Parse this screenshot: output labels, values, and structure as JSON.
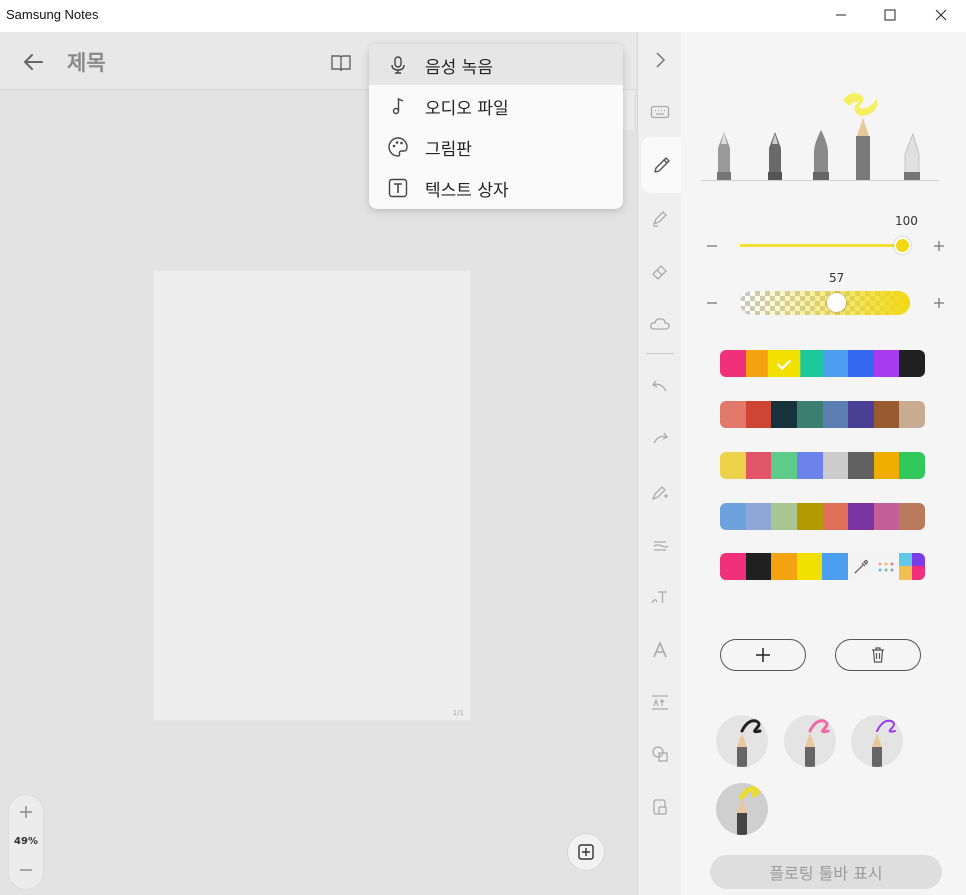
{
  "window": {
    "title": "Samsung Notes",
    "controls": [
      "minimize-icon",
      "maximize-icon",
      "close-icon"
    ]
  },
  "note": {
    "title": "제목",
    "page_indicator": "1/1",
    "zoom_level": "49%"
  },
  "menu": {
    "items": [
      {
        "label": "음성 녹음",
        "icon": "microphone-icon",
        "highlighted": true
      },
      {
        "label": "오디오 파일",
        "icon": "music-note-icon",
        "highlighted": false
      },
      {
        "label": "그림판",
        "icon": "palette-icon",
        "highlighted": false
      },
      {
        "label": "텍스트 상자",
        "icon": "text-box-icon",
        "highlighted": false
      }
    ]
  },
  "tool_strip": {
    "items": [
      "collapse-chevron-icon",
      "keyboard-icon",
      "pen-icon",
      "highlighter-icon",
      "eraser-icon",
      "lasso-icon",
      "undo-icon",
      "redo-icon",
      "handwriting-icon",
      "straighten-icon",
      "text-convert-icon",
      "font-style-icon",
      "spacing-icon",
      "shapes-icon",
      "lock-icon"
    ],
    "selected": "pen-icon"
  },
  "pen_panel": {
    "pen_types": [
      "fountain-pen-icon",
      "calligraphy-pen-icon",
      "brush-pen-icon",
      "pencil-icon",
      "marker-icon"
    ],
    "selected_pen": "pencil-icon",
    "size": {
      "value": "100",
      "fraction": 1.0
    },
    "opacity": {
      "value": "57",
      "fraction": 0.57
    },
    "accent_color": "#f2d913",
    "palettes": [
      [
        "#f0307a",
        "#f2a30f",
        "#f2e000",
        "#1cc99a",
        "#4b9ef0",
        "#3567f0",
        "#a63bf0",
        "#202020"
      ],
      [
        "#e2786a",
        "#cf4534",
        "#16323a",
        "#3a7f70",
        "#5a7fb0",
        "#4a3f95",
        "#9a5a30",
        "#c8ac92"
      ],
      [
        "#ecd24b",
        "#e25468",
        "#5fcb8a",
        "#6d82ea",
        "#cccccc",
        "#616161",
        "#f0ad00",
        "#31c85c"
      ],
      [
        "#6ea2df",
        "#8ea7d6",
        "#a8c691",
        "#b39a00",
        "#e06f5a",
        "#7a35a3",
        "#c45f9a",
        "#b97b5c"
      ],
      [
        "#f0307a",
        "#202020",
        "#f2a30f",
        "#f2e000",
        "#4b9ef0"
      ]
    ],
    "selected_swatch": {
      "row": 0,
      "index": 2
    },
    "palette_tools": [
      "eyedropper-icon",
      "color-dots-icon",
      "custom-color-icon"
    ],
    "add_label": "+",
    "delete_icon": "trash-icon",
    "presets": [
      {
        "color": "#202020",
        "selected": false
      },
      {
        "color": "#f06aa8",
        "selected": false
      },
      {
        "color": "#9a3bf0",
        "selected": false
      },
      {
        "color": "#f2e000",
        "selected": true
      }
    ],
    "floating_toolbar_label": "플로팅 툴바 표시"
  }
}
